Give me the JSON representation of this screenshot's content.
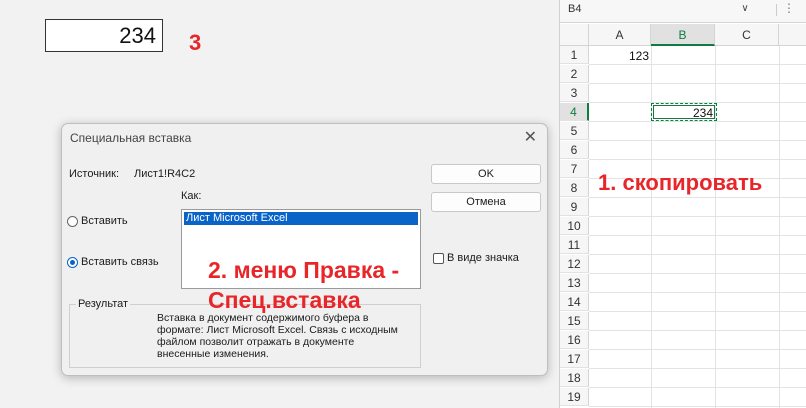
{
  "pasted_box": {
    "value": "234"
  },
  "annotations": {
    "step1": "1. скопировать",
    "step2_line1": "2. меню Правка -",
    "step2_line2": "Спец.вставка",
    "step3": "3"
  },
  "spreadsheet": {
    "name_box": "B4",
    "name_box_dropdown_icon": "chevron-down-icon",
    "more_icon": "vertical-dots-icon",
    "columns": [
      "A",
      "B",
      "C"
    ],
    "selected_column": "B",
    "rows": [
      "1",
      "2",
      "3",
      "4",
      "5",
      "6",
      "7",
      "8",
      "9",
      "10",
      "11",
      "12",
      "13",
      "14",
      "15",
      "16",
      "17",
      "18",
      "19"
    ],
    "selected_row": "4",
    "cells": {
      "A1": "123",
      "B4": "234"
    },
    "accent_color": "#107c41"
  },
  "dialog": {
    "title": "Специальная вставка",
    "close_icon": "close-icon",
    "source_label": "Источник:",
    "source_value": "Лист1!R4C2",
    "as_label": "Как:",
    "list_items": [
      "Лист Microsoft Excel"
    ],
    "radio_paste": "Вставить",
    "radio_paste_link": "Вставить связь",
    "ok_button": "OK",
    "cancel_button": "Отмена",
    "display_as_icon": "В виде значка",
    "result_label": "Результат",
    "result_line1": "Вставка в документ содержимого буфера в",
    "result_line2": "формате: Лист Microsoft Excel.  Связь с исходным",
    "result_line3": "файлом позволит отражать в документе",
    "result_line4": "внесенные изменения."
  },
  "colors": {
    "annotation": "#e8262a",
    "selection": "#0a64c8"
  }
}
